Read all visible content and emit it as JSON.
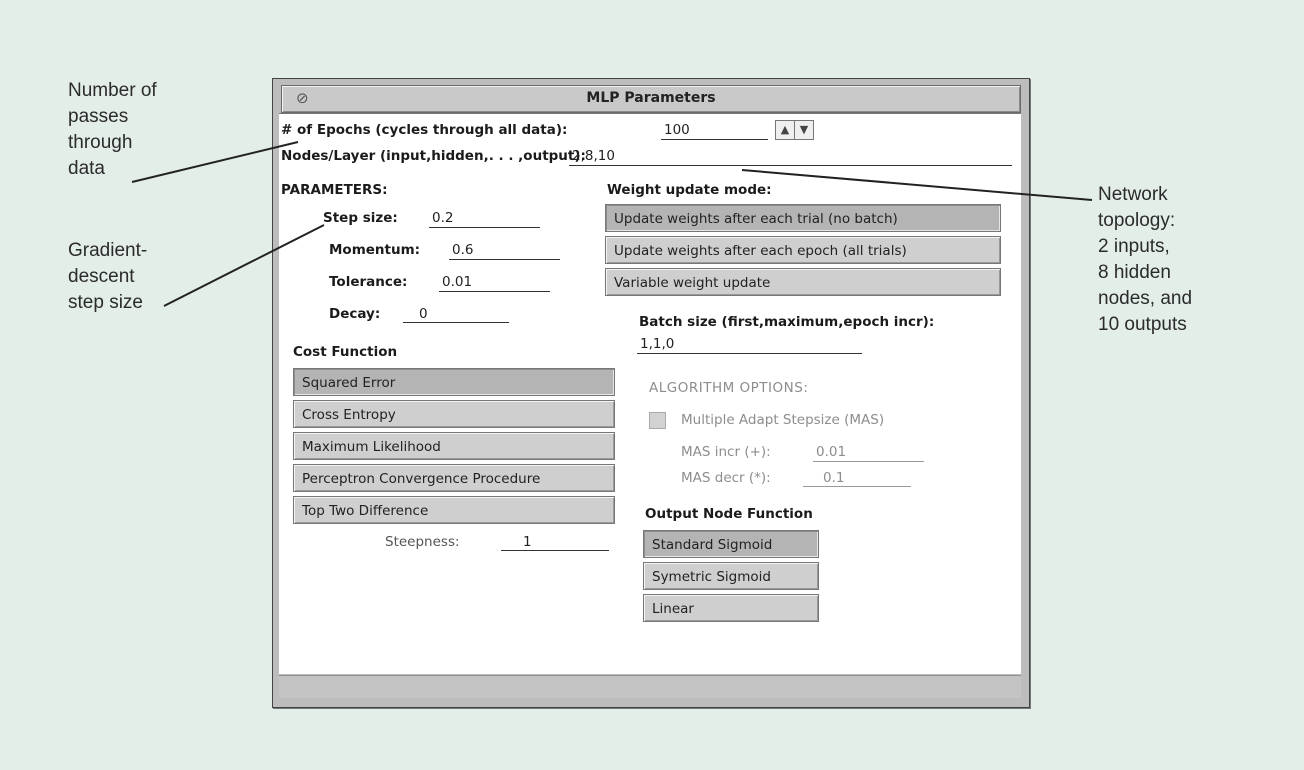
{
  "annotations": {
    "left_1": [
      "Number of",
      "passes",
      "through",
      "data"
    ],
    "left_2": [
      "Gradient-",
      "descent",
      "step size"
    ],
    "right_1": [
      "Network",
      "topology:",
      "2 inputs,",
      "8 hidden",
      "nodes, and",
      "10 outputs"
    ]
  },
  "window": {
    "title": "MLP Parameters",
    "menu_icon": "window-menu-icon"
  },
  "epochs": {
    "label": "# of Epochs (cycles through all data):",
    "value": "100",
    "up": "▲",
    "down": "▼"
  },
  "nodes": {
    "label": "Nodes/Layer (input,hidden,. . . ,output):",
    "value": "2,8,10"
  },
  "parameters": {
    "heading": "PARAMETERS:",
    "step_label": "Step size:",
    "step_value": "0.2",
    "momentum_label": "Momentum:",
    "momentum_value": "0.6",
    "tolerance_label": "Tolerance:",
    "tolerance_value": "0.01",
    "decay_label": "Decay:",
    "decay_value": "0"
  },
  "weight_mode": {
    "heading": "Weight update mode:",
    "options": [
      "Update weights after each trial (no batch)",
      "Update weights after each epoch (all trials)",
      "Variable weight update"
    ],
    "selected": 0
  },
  "batch": {
    "label": "Batch size (first,maximum,epoch incr):",
    "value": "1,1,0"
  },
  "cost": {
    "heading": "Cost Function",
    "options": [
      "Squared Error",
      "Cross Entropy",
      "Maximum Likelihood",
      "Perceptron Convergence Procedure",
      "Top Two Difference"
    ],
    "selected": 0,
    "steepness_label": "Steepness:",
    "steepness_value": "1"
  },
  "algorithm": {
    "heading": "ALGORITHM OPTIONS:",
    "mas_label": "Multiple Adapt Stepsize (MAS)",
    "incr_label": "MAS incr (+):",
    "incr_value": "0.01",
    "decr_label": "MAS decr (*):",
    "decr_value": "0.1"
  },
  "output_fn": {
    "heading": "Output Node Function",
    "options": [
      "Standard Sigmoid",
      "Symetric Sigmoid",
      "Linear"
    ],
    "selected": 0
  },
  "colors": {
    "background": "#e3eee8",
    "window": "#bdbdbd",
    "content": "#ffffff",
    "button": "#cfcfcf",
    "button_selected": "#b4b4b4"
  }
}
